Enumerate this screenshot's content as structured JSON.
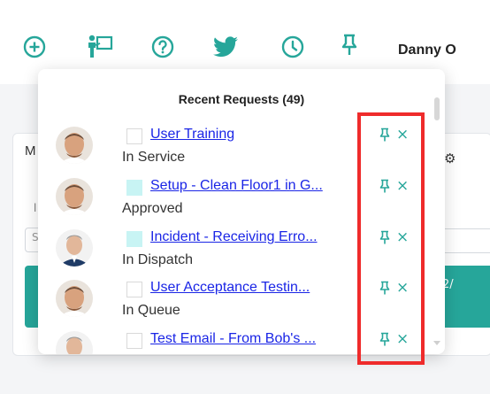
{
  "colors": {
    "accent": "#26a69a",
    "link": "#1a25e6",
    "highlight": "#ef2b2b",
    "checkbox_tint": "#c8f4f4"
  },
  "toolbar": {
    "icons": [
      "add-circle-icon",
      "presentation-icon",
      "help-circle-icon",
      "twitter-icon",
      "clock-icon",
      "pin-icon"
    ],
    "username": "Danny O"
  },
  "background": {
    "left_text": "M",
    "label_text": "l",
    "field_text": "S",
    "right_text": "2/"
  },
  "popup": {
    "title": "Recent Requests (49)",
    "requests": [
      {
        "title": "User Training",
        "status": "In Service",
        "checkbox_tinted": false,
        "avatar": "avatar-1"
      },
      {
        "title": "Setup - Clean Floor1 in G...",
        "status": "Approved",
        "checkbox_tinted": true,
        "avatar": "avatar-1"
      },
      {
        "title": "Incident - Receiving Erro...",
        "status": "In Dispatch",
        "checkbox_tinted": true,
        "avatar": "avatar-2"
      },
      {
        "title": "User Acceptance Testin...",
        "status": "In Queue",
        "checkbox_tinted": false,
        "avatar": "avatar-1"
      },
      {
        "title": "Test Email - From Bob's ...",
        "status": "",
        "checkbox_tinted": false,
        "avatar": "avatar-2"
      }
    ],
    "pin_icon": "pin-icon",
    "close_icon": "close-icon",
    "close_glyph": "×"
  }
}
